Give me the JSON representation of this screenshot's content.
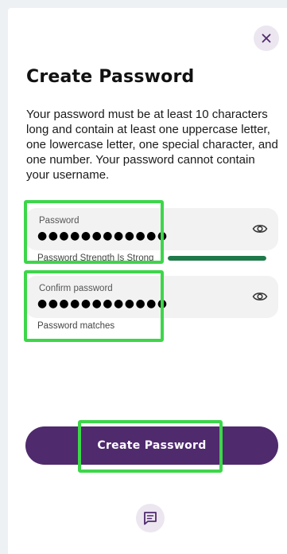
{
  "page": {
    "title": "Create Password",
    "description": "Your password must be at least 10 characters long and contain at least one uppercase letter, one lowercase letter, one special character, and one number. Your password cannot contain your username."
  },
  "close": {
    "icon": "close-icon"
  },
  "password_field": {
    "label": "Password",
    "value": "●●●●●●●●●●●●",
    "icon": "eye-icon"
  },
  "strength": {
    "label": "Password Strength Is Strong",
    "level": 1.0,
    "color": "#1f7a4a"
  },
  "confirm_field": {
    "label": "Confirm password",
    "value": "●●●●●●●●●●●●",
    "icon": "eye-icon",
    "status": "Password matches"
  },
  "submit": {
    "label": "Create Password"
  },
  "chat": {
    "icon": "chat-icon"
  },
  "colors": {
    "primary": "#4f2a6d",
    "highlight": "#3dd64a",
    "field_bg": "#f2f2f2"
  }
}
